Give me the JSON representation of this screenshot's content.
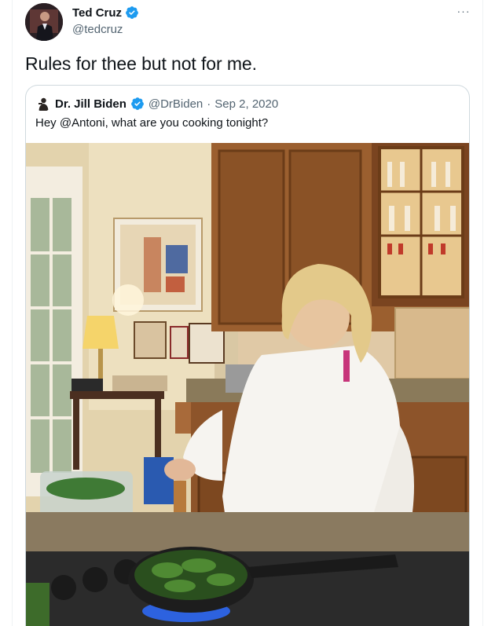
{
  "tweet": {
    "author_name": "Ted Cruz",
    "author_handle": "@tedcruz",
    "text": "Rules for thee but not for me.",
    "more_label": "···"
  },
  "quoted": {
    "author_name": "Dr. Jill Biden",
    "author_handle": "@DrBiden",
    "separator": "·",
    "date": "Sep 2, 2020",
    "text": "Hey @Antoni, what are you cooking tonight?"
  },
  "colors": {
    "verified": "#1d9bf0",
    "secondary_text": "#536471",
    "border": "#cfd9de"
  },
  "icons": {
    "verified": "verified-badge-icon",
    "more": "more-options-icon"
  }
}
